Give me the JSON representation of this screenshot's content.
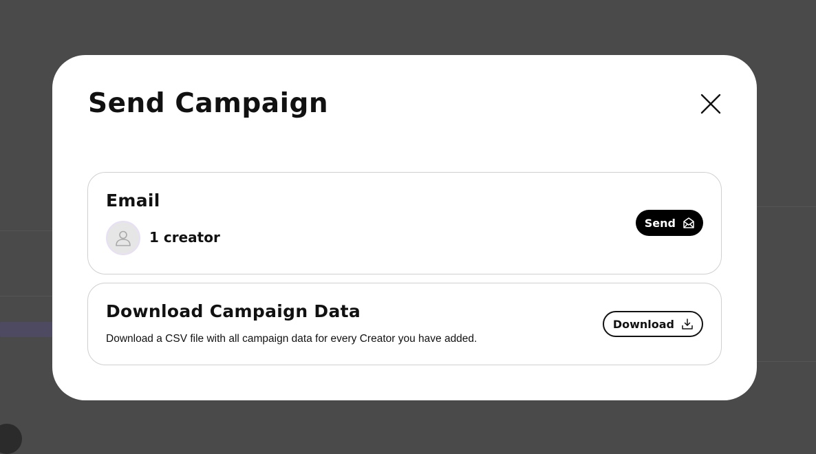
{
  "modal": {
    "title": "Send Campaign",
    "close_icon": "close-icon"
  },
  "email_card": {
    "title": "Email",
    "avatar_icon": "user-icon",
    "creator_count": "1 creator",
    "send_label": "Send",
    "send_icon": "mail-open-icon"
  },
  "download_card": {
    "title": "Download Campaign Data",
    "description": "Download a CSV file with all campaign data for every Creator you have added.",
    "download_label": "Download",
    "download_icon": "download-icon"
  },
  "colors": {
    "overlay": "#4a4a4a",
    "modal_background": "#ffffff",
    "primary_button": "#000000",
    "card_border": "#cfcfcf",
    "avatar_ring": "#e8dff5"
  }
}
